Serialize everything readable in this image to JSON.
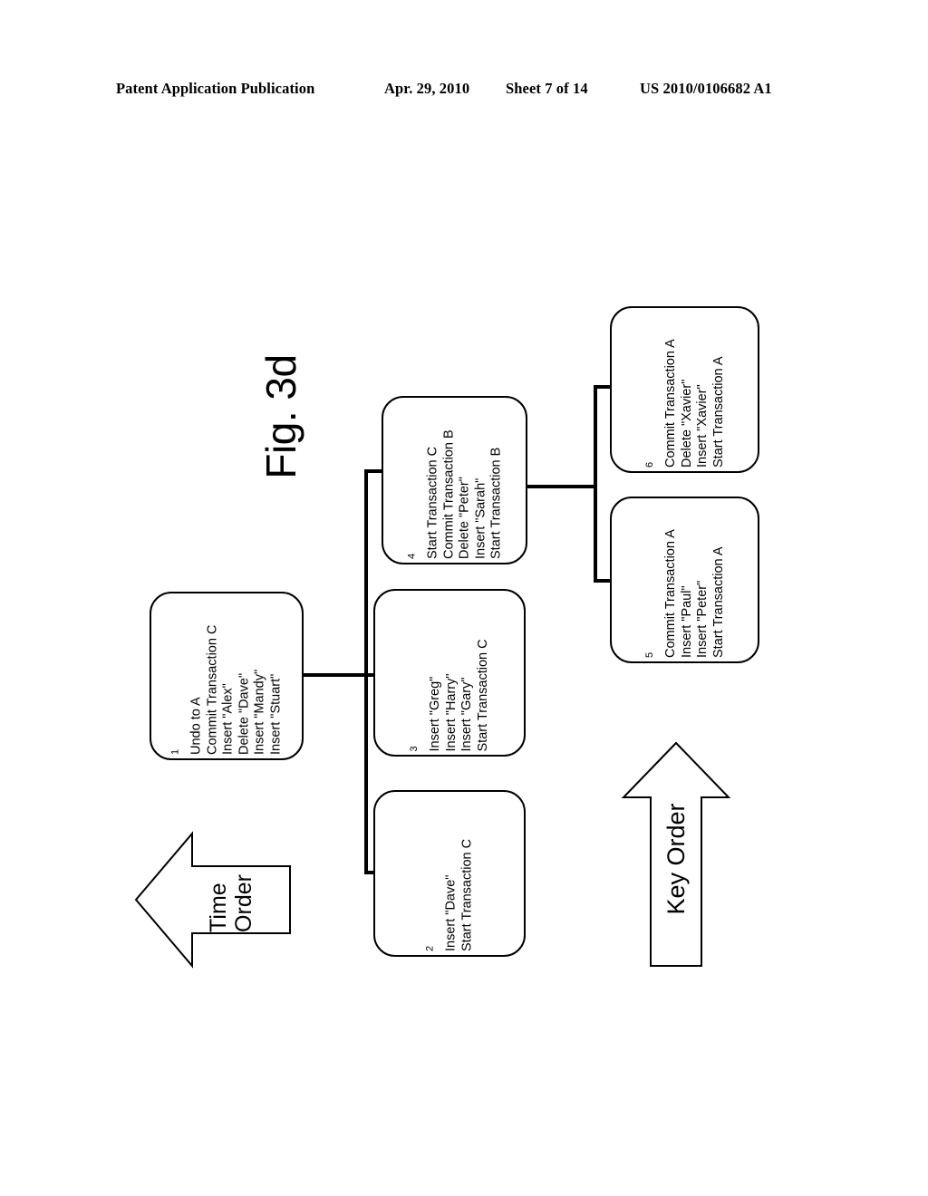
{
  "header": {
    "publication": "Patent Application Publication",
    "date": "Apr. 29, 2010",
    "sheet": "Sheet 7 of 14",
    "patent_number": "US 2010/0106682 A1"
  },
  "figure": {
    "title": "Fig. 3d",
    "nodes": [
      {
        "id": "1",
        "number": "1",
        "lines": [
          "Undo to A",
          "Commit Transaction C",
          "Insert \"Alex\"",
          "Delete \"Dave\"",
          "Insert \"Mandy\"",
          "Insert \"Stuart\""
        ]
      },
      {
        "id": "2",
        "number": "2",
        "lines": [
          "Insert \"Dave\"",
          "Start Transaction C"
        ]
      },
      {
        "id": "3",
        "number": "3",
        "lines": [
          "Insert \"Greg\"",
          "Insert \"Harry\"",
          "Insert \"Gary\"",
          "Start Transaction C"
        ]
      },
      {
        "id": "4",
        "number": "4",
        "lines": [
          "Start Transaction C",
          "Commit Transaction B",
          "Delete \"Peter\"",
          "Insert \"Sarah\"",
          "Start Transaction B"
        ]
      },
      {
        "id": "5",
        "number": "5",
        "lines": [
          "Commit Transaction A",
          "Insert \"Paul\"",
          "Insert \"Peter\"",
          "Start Transaction A"
        ]
      },
      {
        "id": "6",
        "number": "6",
        "lines": [
          "Commit Transaction A",
          "Delete \"Xavier\"",
          "Insert \"Xavier\"",
          "Start Transaction A"
        ]
      }
    ],
    "arrows": [
      {
        "id": "time-order",
        "label_line_1": "Time",
        "label_line_2": "Order"
      },
      {
        "id": "key-order",
        "label": "Key Order"
      }
    ]
  },
  "colors": {
    "ink": "#000000",
    "paper": "#ffffff"
  }
}
